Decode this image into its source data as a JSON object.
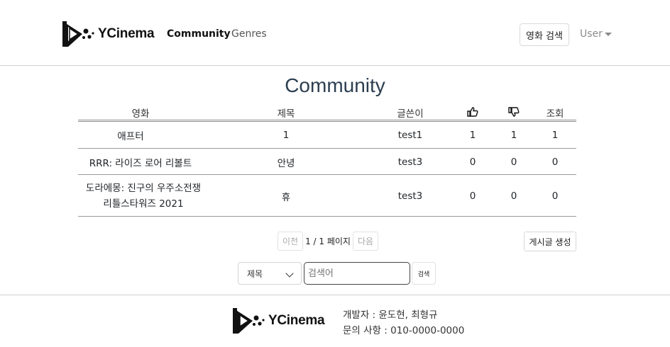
{
  "header": {
    "brand": "YCinema",
    "nav": {
      "community": "Community",
      "genres": "Genres"
    },
    "movie_search_label": "영화 검색",
    "user_label": "User"
  },
  "page": {
    "title": "Community"
  },
  "table": {
    "columns": {
      "movie": "영화",
      "title": "제목",
      "writer": "글쓴이",
      "views": "조회"
    },
    "rows": [
      {
        "movie": "애프터",
        "title": "1",
        "writer": "test1",
        "likes": "1",
        "dislikes": "1",
        "views": "1"
      },
      {
        "movie": "RRR: 라이즈 로어 리볼트",
        "title": "안녕",
        "writer": "test3",
        "likes": "0",
        "dislikes": "0",
        "views": "0"
      },
      {
        "movie": "도라에몽: 진구의 우주소전쟁 리틀스타워즈 2021",
        "title": "휴",
        "writer": "test3",
        "likes": "0",
        "dislikes": "0",
        "views": "0"
      }
    ]
  },
  "pagination": {
    "prev": "이전",
    "info": "1 / 1 페이지",
    "next": "다음"
  },
  "create_post_label": "게시글 생성",
  "search": {
    "select_value": "제목",
    "placeholder": "검색어",
    "button": "검색"
  },
  "footer": {
    "brand": "YCinema",
    "developers": "개발자 : 윤도현, 최형규",
    "contact": "문의 사항 : 010-0000-0000"
  }
}
